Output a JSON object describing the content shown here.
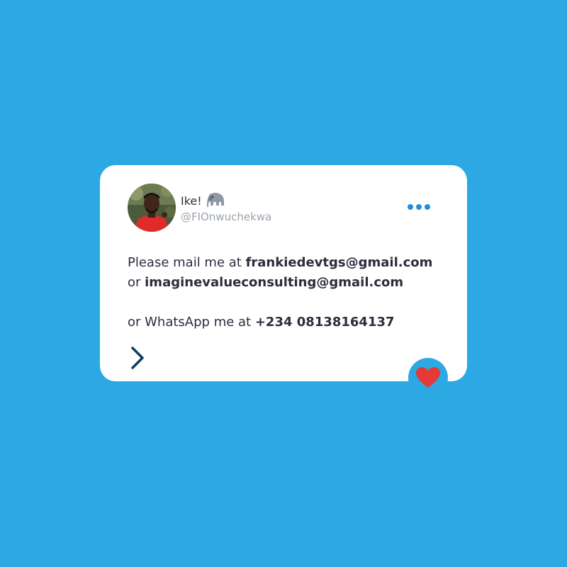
{
  "tweet": {
    "author": {
      "display_name": "Ike!",
      "name_emoji_icon": "elephant-icon",
      "handle": "@FIOnwuchekwa",
      "avatar": "profile-photo"
    },
    "more_icon": "more-dots-icon",
    "body": {
      "line1_prefix": "Please mail me at ",
      "line1_email": "frankiedevtgs@gmail.com",
      "line2_prefix": "or ",
      "line2_email": "imaginevalueconsulting@gmail.com",
      "line3_prefix": "or WhatsApp me at ",
      "line3_phone": "+234 08138164137"
    },
    "next_icon": "chevron-right-icon",
    "like_icon": "heart-icon"
  },
  "colors": {
    "background": "#2CA9E2",
    "card": "#FFFFFF",
    "text": "#2B2D3E",
    "muted": "#9AA3AD",
    "accent": "#2190DA",
    "heart": "#E53935",
    "chevron": "#0F3D5C"
  }
}
